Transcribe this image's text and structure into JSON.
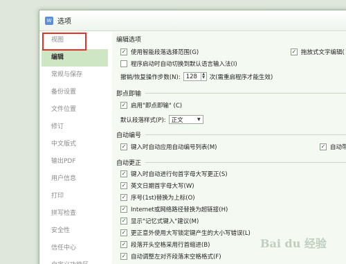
{
  "window": {
    "title": "选项"
  },
  "sidebar": {
    "items": [
      {
        "label": "视图"
      },
      {
        "label": "编辑"
      },
      {
        "label": "常规与保存"
      },
      {
        "label": "备份设置"
      },
      {
        "label": "文件位置"
      },
      {
        "label": "修订"
      },
      {
        "label": "中文版式"
      },
      {
        "label": "输出PDF"
      },
      {
        "label": "用户信息"
      },
      {
        "label": "打印"
      },
      {
        "label": "拼写检查"
      },
      {
        "label": "安全性"
      },
      {
        "label": "信任中心"
      },
      {
        "label": "自定义功能区"
      }
    ],
    "selected": "编辑"
  },
  "sections": {
    "edit_options": {
      "title": "编辑选项",
      "smart_select": "使用智能段落选择范围(G)",
      "drag_edit": "拖放式文字编辑(",
      "auto_switch_lang": "程序启动时自动切换到默认语言输入法(I)",
      "undo_label": "撤销/恢复操作步数(N):",
      "undo_value": "128",
      "undo_suffix": "次(需重启程序才能生效)"
    },
    "instant": {
      "title": "即点即输",
      "enable": "启用\"即点即输\" (C)",
      "default_style_label": "默认段落样式(P):",
      "default_style_value": "正文"
    },
    "autonumber": {
      "title": "自动编号",
      "apply_list": "键入时自动应用自动编号列表(M)",
      "auto_tab": "自动带"
    },
    "autocorrect": {
      "title": "自动更正",
      "items": [
        "键入时自动进行句首字母大写更正(S)",
        "英文日期首字母大写(W)",
        "序号(1st)替换为上标(O)",
        "Internet或网络路径替换为超链接(H)",
        "显示\"记忆式键入\"建议(M)",
        "更正意外使用大写锁定键产生的大小写错误(L)",
        "段落开头空格采用行首缩进(B)",
        "自动调整左对齐段落末空格格式(F)"
      ]
    }
  },
  "watermark": "Bai du 经验"
}
